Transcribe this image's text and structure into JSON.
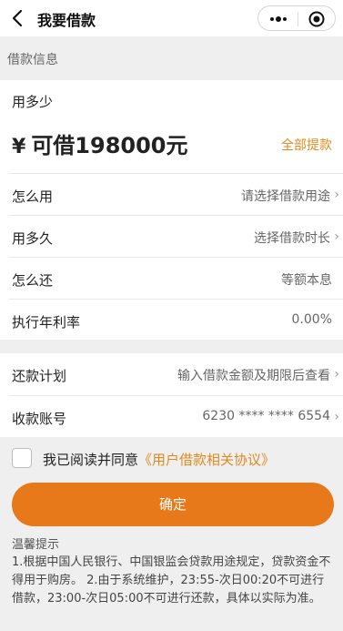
{
  "header": {
    "title": "我要借款",
    "back_icon": "back-arrow-icon",
    "more_icon": "more-dots-icon",
    "close_icon": "target-close-icon"
  },
  "section_title": "借款信息",
  "amount": {
    "question": "用多少",
    "currency_symbol": "¥",
    "available_text": "可借198000元",
    "withdraw_all_label": "全部提款"
  },
  "rows": [
    {
      "label": "怎么用",
      "value": "请选择借款用途",
      "has_chevron": true
    },
    {
      "label": "用多久",
      "value": "选择借款时长",
      "has_chevron": true
    },
    {
      "label": "怎么还",
      "value": "等额本息",
      "has_chevron": false
    },
    {
      "label": "执行年利率",
      "value": "0.00%",
      "has_chevron": false
    }
  ],
  "rows2": [
    {
      "label": "还款计划",
      "value": "输入借款金额及期限后查看",
      "has_chevron": true
    },
    {
      "label": "收款账号",
      "value": "6230 **** **** 6554",
      "has_chevron": true
    }
  ],
  "chevron": "›",
  "agreement": {
    "prefix": "我已阅读并同意",
    "link": "《用户借款相关协议》",
    "checked": false
  },
  "confirm_label": "确定",
  "tips": {
    "title": "温馨提示",
    "body": "1.根据中国人民银行、中国银监会贷款用途规定，贷款资金不得用于购房。 2.由于系统维护，23:55-次日00:20不可进行借款，23:00-次日05:00不可进行还款，具体以实际为准。"
  },
  "colors": {
    "accent": "#e08a1e",
    "button": "#e8791b",
    "background": "#efefef"
  }
}
